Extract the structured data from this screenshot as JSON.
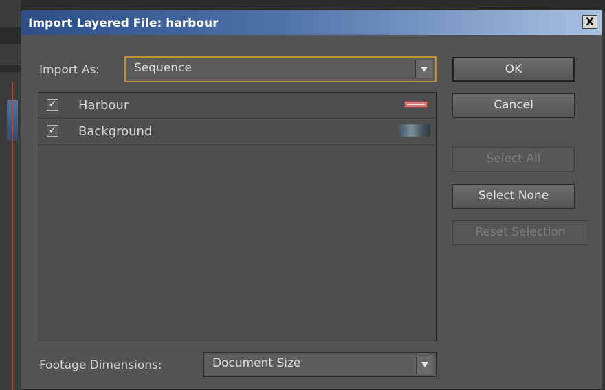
{
  "dialog": {
    "title": "Import Layered File: harbour",
    "close_label": "X"
  },
  "import_as": {
    "label": "Import As:",
    "value": "Sequence"
  },
  "layers": [
    {
      "name": "Harbour",
      "checked": true,
      "check_glyph": "✓"
    },
    {
      "name": "Background",
      "checked": true,
      "check_glyph": "✓"
    }
  ],
  "buttons": {
    "ok": "OK",
    "cancel": "Cancel",
    "select_all": "Select All",
    "select_none": "Select None",
    "reset_selection": "Reset Selection"
  },
  "footage": {
    "label": "Footage Dimensions:",
    "value": "Document Size"
  },
  "colors": {
    "dialog_bg": "#535353",
    "titlebar_start": "#2d4e86",
    "focus_border": "#c8912b"
  }
}
